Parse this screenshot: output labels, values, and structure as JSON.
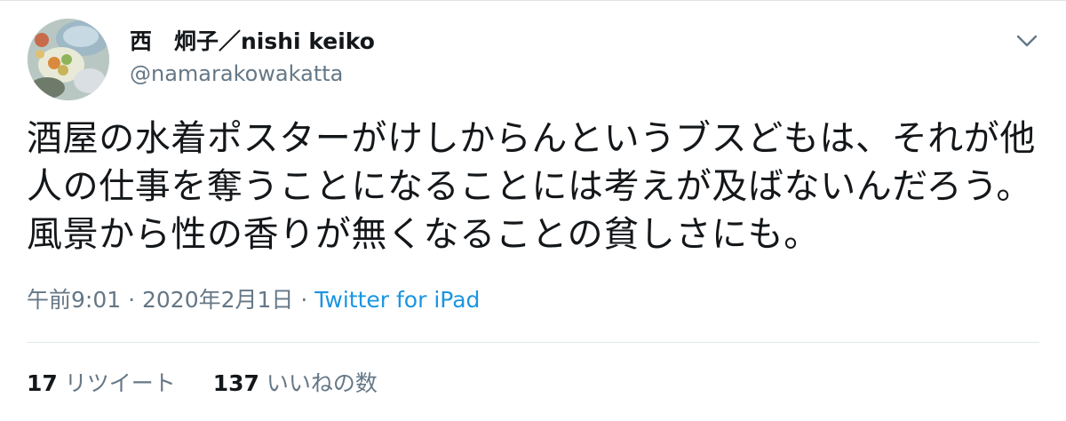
{
  "tweet": {
    "user": {
      "display_name": "西　炯子／nishi keiko",
      "handle": "@namarakowakatta"
    },
    "text": "酒屋の水着ポスターがけしからんというブスどもは、それが他人の仕事を奪うことになることには考えが及ばないんだろう。風景から性の香りが無くなることの貧しさにも。",
    "meta": {
      "time": "午前9:01",
      "separator": " · ",
      "date": "2020年2月1日",
      "source": "Twitter for iPad"
    },
    "stats": {
      "retweets": {
        "count": "17",
        "label": "リツイート"
      },
      "likes": {
        "count": "137",
        "label": "いいねの数"
      }
    },
    "icons": {
      "menu": "chevron-down-icon",
      "avatar": "avatar-image"
    },
    "colors": {
      "text": "#14171a",
      "secondary": "#657786",
      "link": "#1b95e0",
      "divider": "#e1e8ed"
    }
  }
}
